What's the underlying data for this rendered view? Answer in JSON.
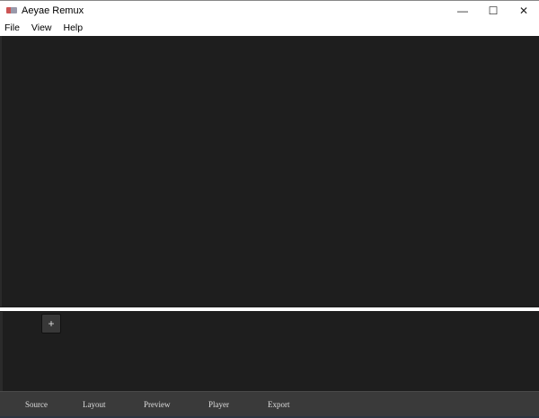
{
  "window": {
    "title": "Aeyae Remux",
    "minimize": "—",
    "maximize": "☐",
    "close": "✕"
  },
  "menu": [
    "File",
    "View",
    "Help"
  ],
  "panel": {
    "add_label": "+"
  },
  "tabs": [
    "Source",
    "Layout",
    "Preview",
    "Player",
    "Export"
  ]
}
